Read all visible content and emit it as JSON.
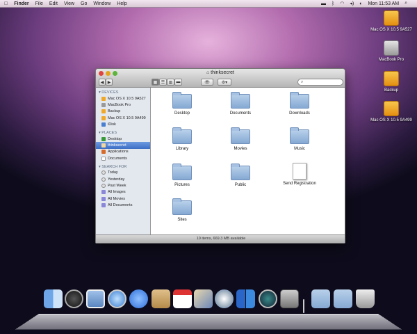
{
  "menubar": {
    "app": "Finder",
    "items": [
      "File",
      "Edit",
      "View",
      "Go",
      "Window",
      "Help"
    ],
    "clock": "Mon 11:53 AM"
  },
  "desktop": [
    {
      "label": "Mac OS X 10.5 9A527",
      "kind": "usb"
    },
    {
      "label": "MacBook Pro",
      "kind": "hd"
    },
    {
      "label": "Backup",
      "kind": "usb"
    },
    {
      "label": "Mac OS X 10.5 9A499",
      "kind": "usb"
    }
  ],
  "window": {
    "title": "thinksecret",
    "status": "10 items, 669.3 MB available",
    "sidebar": {
      "devices_header": "DEVICES",
      "devices": [
        "Mac OS X 10.5 9A527",
        "MacBook Pro",
        "Backup",
        "Mac OS X 10.5 9A499",
        "iDisk"
      ],
      "places_header": "PLACES",
      "places": [
        "Desktop",
        "thinksecret",
        "Applications",
        "Documents"
      ],
      "search_header": "SEARCH FOR",
      "search": [
        "Today",
        "Yesterday",
        "Past Week",
        "All Images",
        "All Movies",
        "All Documents"
      ]
    },
    "items": [
      "Desktop",
      "Documents",
      "Downloads",
      "Library",
      "Movies",
      "Music",
      "Pictures",
      "Public",
      "Send Registration",
      "Sites"
    ]
  },
  "dock": [
    "Finder",
    "Dashboard",
    "Mail",
    "Safari",
    "iChat",
    "Address Book",
    "iCal",
    "iPhoto",
    "iTunes",
    "Spaces",
    "Time Machine",
    "System Preferences",
    "Documents",
    "Downloads",
    "Trash"
  ],
  "colors": {
    "accent": "#3c6ec4",
    "usb": "#f0a828"
  }
}
